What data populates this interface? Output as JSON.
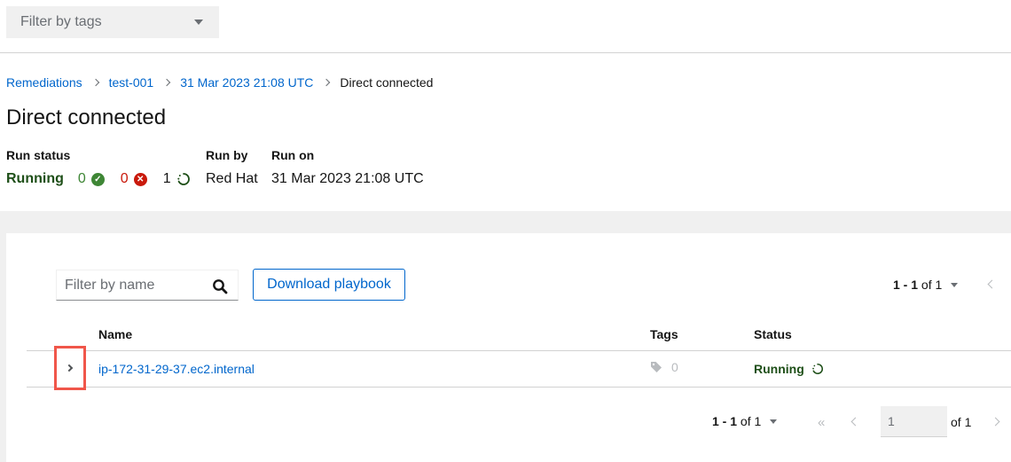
{
  "top_filter": {
    "placeholder": "Filter by tags"
  },
  "breadcrumb": {
    "items": [
      "Remediations",
      "test-001",
      "31 Mar 2023 21:08 UTC"
    ],
    "current": "Direct connected"
  },
  "page_title": "Direct connected",
  "run_info": {
    "status_label": "Run status",
    "status": "Running",
    "success_count": "0",
    "failed_count": "0",
    "running_count": "1",
    "run_by_label": "Run by",
    "run_by": "Red Hat",
    "run_on_label": "Run on",
    "run_on": "31 Mar 2023 21:08 UTC"
  },
  "toolbar": {
    "name_filter_placeholder": "Filter by name",
    "download_label": "Download playbook",
    "pagination_range": "1 - 1",
    "pagination_of": "of 1"
  },
  "table": {
    "columns": [
      "Name",
      "Tags",
      "Status"
    ],
    "rows": [
      {
        "name": "ip-172-31-29-37.ec2.internal",
        "tags": "0",
        "status": "Running"
      }
    ]
  },
  "footer_pagination": {
    "range": "1 - 1",
    "of": "of 1",
    "page": "1",
    "of_pages": "of 1"
  },
  "colors": {
    "link": "#0066cc",
    "success": "#3e8635",
    "danger": "#c9190b",
    "running_text": "#1e4f18",
    "highlight": "#f0564a"
  }
}
